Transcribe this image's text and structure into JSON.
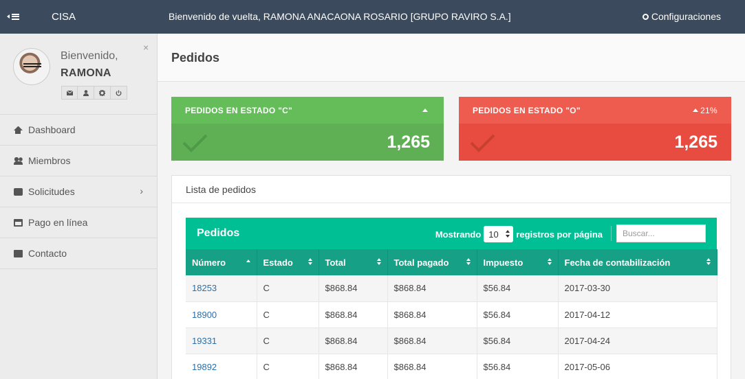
{
  "topbar": {
    "brand": "CISA",
    "welcome": "Bienvenido de vuelta, RAMONA ANACAONA ROSARIO [GRUPO RAVIRO S.A.]",
    "config_label": "Configuraciones"
  },
  "profile": {
    "greeting": "Bienvenido,",
    "name": "RAMONA",
    "close_glyph": "×",
    "buttons": [
      "mail-icon",
      "user-icon",
      "gear-icon",
      "power-icon"
    ]
  },
  "sidebar": {
    "items": [
      {
        "label": "Dashboard",
        "icon": "home-icon"
      },
      {
        "label": "Miembros",
        "icon": "users-icon"
      },
      {
        "label": "Solicitudes",
        "icon": "box-icon"
      },
      {
        "label": "Pago en línea",
        "icon": "credit-card-icon"
      },
      {
        "label": "Contacto",
        "icon": "envelope-icon"
      }
    ]
  },
  "page": {
    "title": "Pedidos"
  },
  "cards": {
    "c": {
      "title": "PEDIDOS EN ESTADO \"C\"",
      "trend": "",
      "value": "1,265",
      "color": "#65bd5a"
    },
    "o": {
      "title": "PEDIDOS EN ESTADO \"O\"",
      "trend": "21%",
      "value": "1,265",
      "color": "#ee5b4f"
    }
  },
  "panel": {
    "title": "Lista de pedidos"
  },
  "table": {
    "title": "Pedidos",
    "show_prefix": "Mostrando",
    "page_size": "10",
    "show_suffix": "registros por página",
    "search_placeholder": "Buscar...",
    "accent": "#00bf95",
    "columns": [
      "Número",
      "Estado",
      "Total",
      "Total pagado",
      "Impuesto",
      "Fecha de contabilización"
    ],
    "rows": [
      [
        "18253",
        "C",
        "$868.84",
        "$868.84",
        "$56.84",
        "2017-03-30"
      ],
      [
        "18900",
        "C",
        "$868.84",
        "$868.84",
        "$56.84",
        "2017-04-12"
      ],
      [
        "19331",
        "C",
        "$868.84",
        "$868.84",
        "$56.84",
        "2017-04-24"
      ],
      [
        "19892",
        "C",
        "$868.84",
        "$868.84",
        "$56.84",
        "2017-05-06"
      ]
    ]
  }
}
